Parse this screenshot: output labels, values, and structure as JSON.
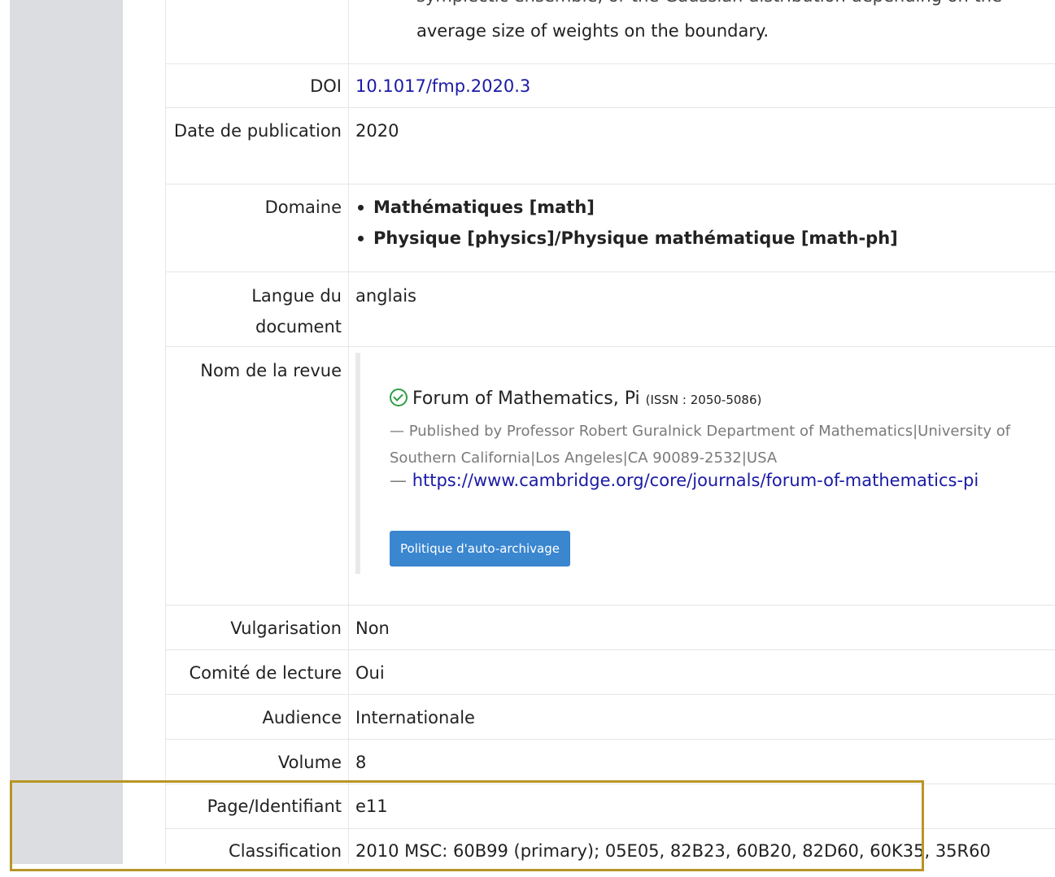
{
  "abstract": {
    "cut_line": "symplectic ensemble, or the Gaussian distribution depending on the",
    "last_line": "average size of weights on the boundary."
  },
  "doi": {
    "label": "DOI",
    "value": "10.1017/fmp.2020.3"
  },
  "date": {
    "label": "Date de publication",
    "value": "2020"
  },
  "domain": {
    "label": "Domaine",
    "items": [
      "Mathématiques [math]",
      "Physique [physics]/Physique mathématique [math-ph]"
    ]
  },
  "language": {
    "label": "Langue du document",
    "value": "anglais"
  },
  "journal": {
    "label": "Nom de la revue",
    "title": "Forum of Mathematics, Pi",
    "issn": "(ISSN : 2050-5086)",
    "publisher": "— Published by Professor Robert Guralnick Department of Mathematics|University of Southern California|Los Angeles|CA 90089-2532|USA",
    "url_prefix": "— ",
    "url": "https://www.cambridge.org/core/journals/forum-of-mathematics-pi",
    "policy_button": "Politique d'auto-archivage"
  },
  "popularization": {
    "label": "Vulgarisation",
    "value": "Non"
  },
  "peer_review": {
    "label": "Comité de lecture",
    "value": "Oui"
  },
  "audience": {
    "label": "Audience",
    "value": "Internationale"
  },
  "volume": {
    "label": "Volume",
    "value": "8"
  },
  "page_id": {
    "label": "Page/Identifiant",
    "value": "e11"
  },
  "classification": {
    "label": "Classification",
    "value": "2010 MSC: 60B99 (primary); 05E05, 82B23, 60B20, 82D60, 60K35, 35R60"
  },
  "colors": {
    "link": "#1a1aa6",
    "button": "#3a86cf",
    "check": "#2e9e48",
    "highlight": "#b89526",
    "sidebar": "#dcdde1"
  }
}
